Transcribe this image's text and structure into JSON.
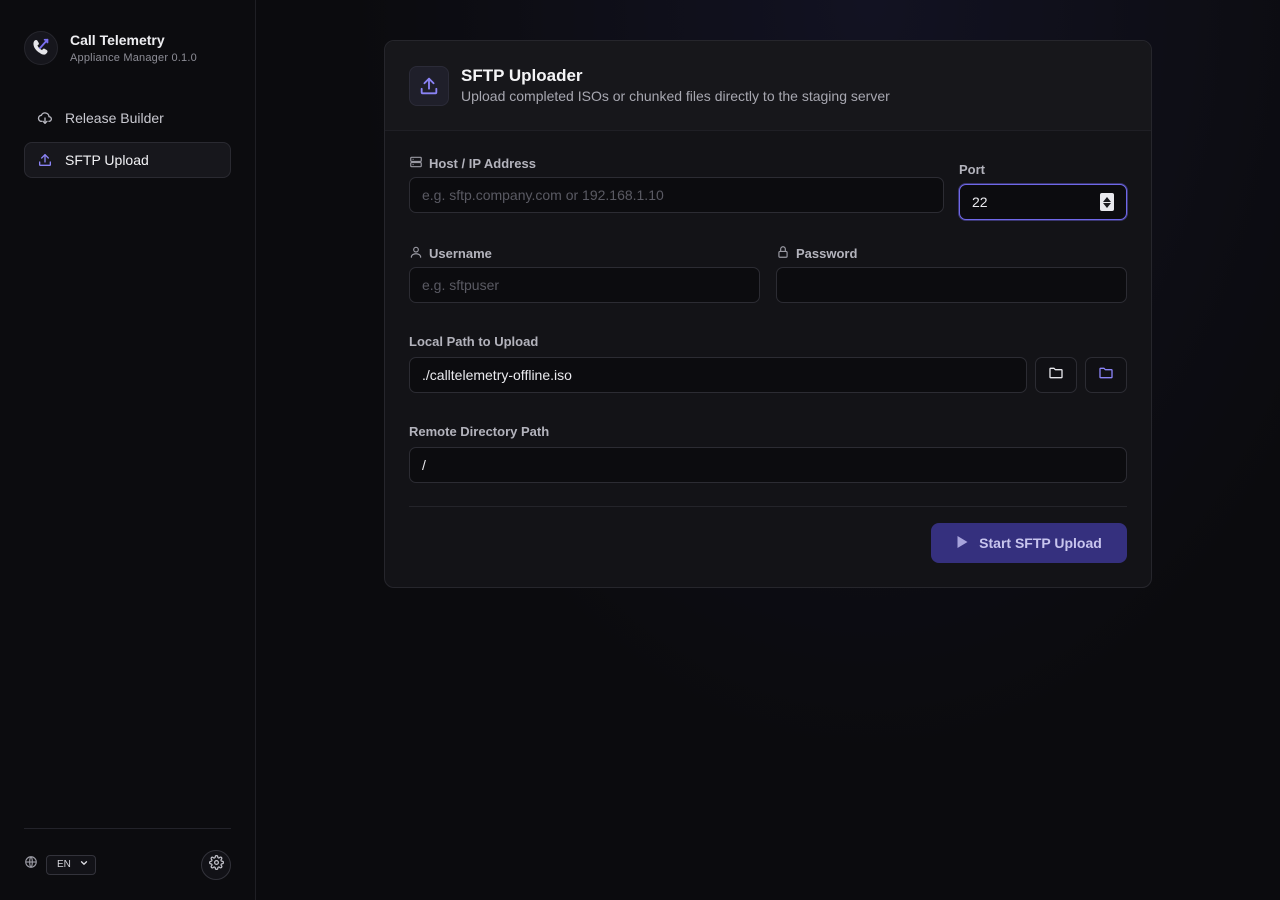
{
  "brand": {
    "title": "Call Telemetry",
    "subtitle": "Appliance Manager 0.1.0"
  },
  "nav": [
    {
      "label": "Release Builder",
      "icon": "cloud-download-icon",
      "active": false
    },
    {
      "label": "SFTP Upload",
      "icon": "upload-icon",
      "active": true
    }
  ],
  "footer": {
    "language": "EN",
    "icons": [
      "globe-icon",
      "gear-icon"
    ]
  },
  "card": {
    "title": "SFTP Uploader",
    "subtitle": "Upload completed ISOs or chunked files directly to the staging server"
  },
  "form": {
    "host": {
      "label": "Host / IP Address",
      "placeholder": "e.g. sftp.company.com or 192.168.1.10",
      "value": ""
    },
    "port": {
      "label": "Port",
      "value": "22"
    },
    "username": {
      "label": "Username",
      "placeholder": "e.g. sftpuser",
      "value": ""
    },
    "password": {
      "label": "Password",
      "value": ""
    },
    "local_path": {
      "label": "Local Path to Upload",
      "value": "./calltelemetry-offline.iso"
    },
    "remote_path": {
      "label": "Remote Directory Path",
      "value": "/"
    },
    "submit_label": "Start SFTP Upload"
  },
  "colors": {
    "accent": "#6f68e8",
    "button": "#35307e"
  }
}
